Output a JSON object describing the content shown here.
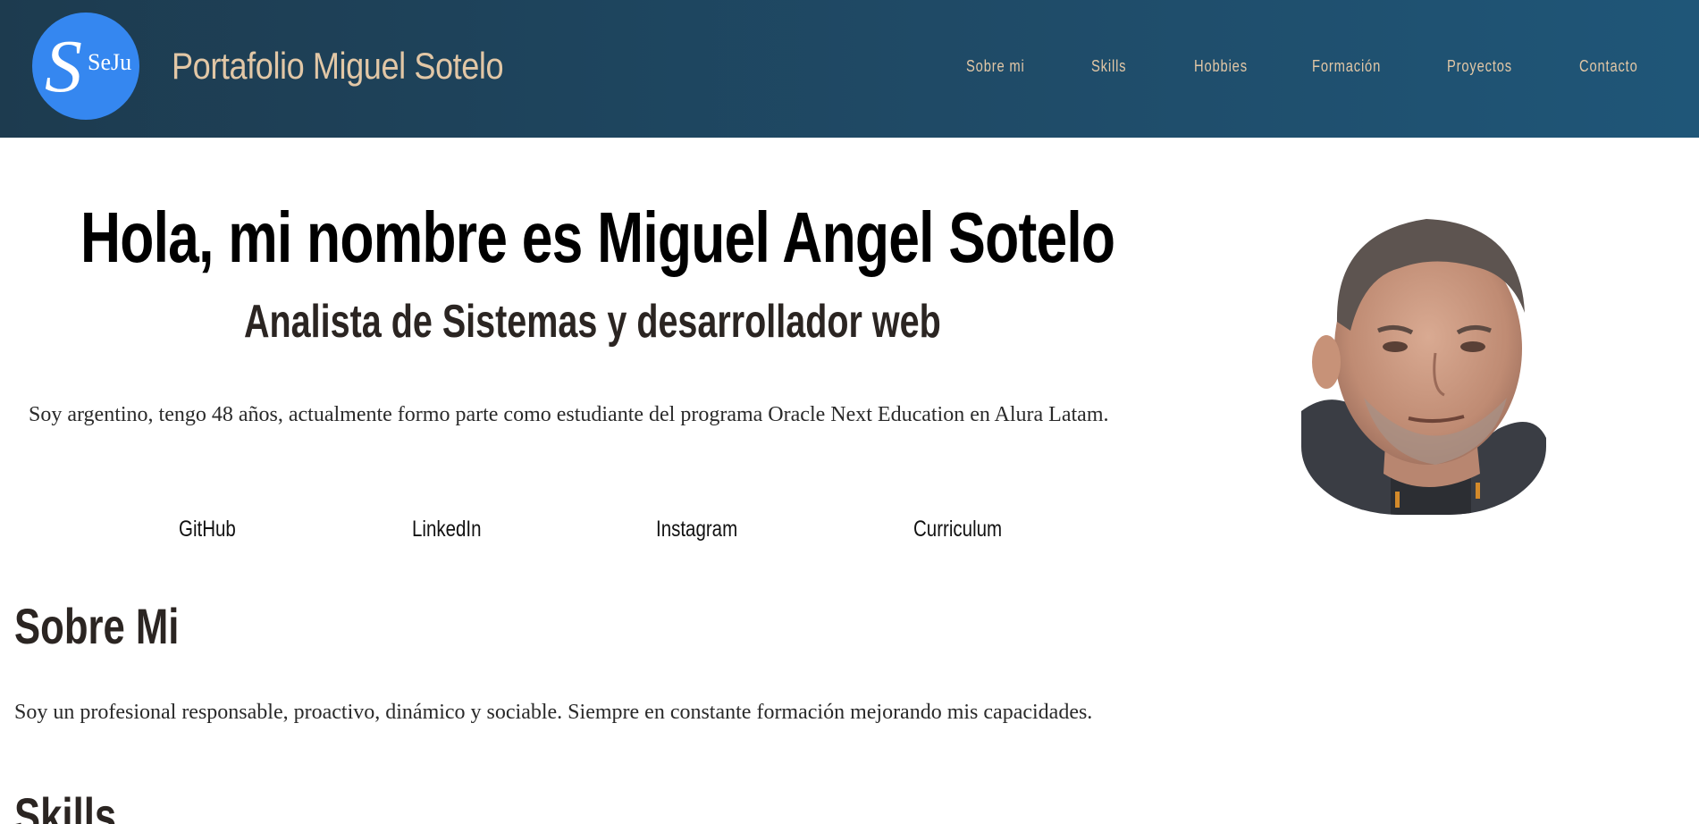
{
  "header": {
    "logo_text": "SeJu",
    "title": "Portafolio Miguel Sotelo",
    "nav": [
      {
        "label": "Sobre mi"
      },
      {
        "label": "Skills"
      },
      {
        "label": "Hobbies"
      },
      {
        "label": "Formación"
      },
      {
        "label": "Proyectos"
      },
      {
        "label": "Contacto"
      }
    ]
  },
  "hero": {
    "title": "Hola, mi nombre es Miguel Angel Sotelo",
    "subtitle": "Analista de Sistemas y desarrollador web",
    "intro": "Soy argentino, tengo 48 años, actualmente formo parte como estudiante del programa Oracle Next Education en Alura Latam.",
    "links": [
      {
        "label": "GitHub"
      },
      {
        "label": "LinkedIn"
      },
      {
        "label": "Instagram"
      },
      {
        "label": "Curriculum"
      }
    ]
  },
  "about": {
    "title": "Sobre Mi",
    "text": "Soy un profesional responsable, proactivo, dinámico y sociable. Siempre en constante formación mejorando mis capacidades."
  },
  "skills": {
    "title": "Skills"
  },
  "colors": {
    "header_start": "#1d3b4f",
    "header_end": "#1f5678",
    "nav_text": "#e2c7a6",
    "logo_bg": "#3587f0"
  }
}
